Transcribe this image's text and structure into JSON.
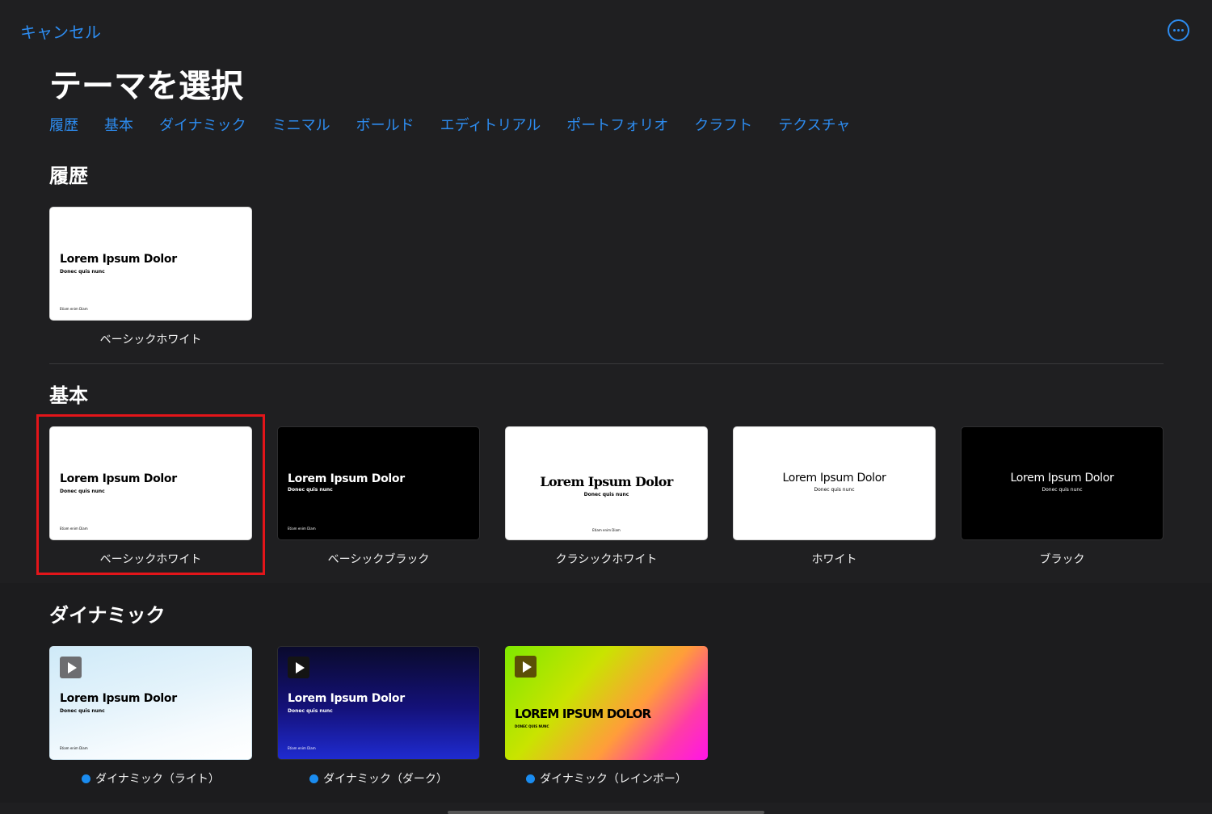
{
  "header": {
    "cancel_label": "キャンセル",
    "more_icon": "ellipsis-circle-icon",
    "title": "テーマを選択"
  },
  "categories": [
    "履歴",
    "基本",
    "ダイナミック",
    "ミニマル",
    "ボールド",
    "エディトリアル",
    "ポートフォリオ",
    "クラフト",
    "テクスチャ"
  ],
  "sections": {
    "recent": {
      "title": "履歴",
      "themes": [
        {
          "name": "ベーシックホワイト",
          "t1": "Lorem Ipsum Dolor",
          "t2": "Donec quis nunc",
          "t3": "Etiam enim Diam"
        }
      ]
    },
    "basic": {
      "title": "基本",
      "themes": [
        {
          "name": "ベーシックホワイト",
          "t1": "Lorem Ipsum Dolor",
          "t2": "Donec quis nunc",
          "t3": "Etiam enim Diam"
        },
        {
          "name": "ベーシックブラック",
          "t1": "Lorem Ipsum Dolor",
          "t2": "Donec quis nunc",
          "t3": "Etiam enim Diam"
        },
        {
          "name": "クラシックホワイト",
          "t1": "Lorem Ipsum Dolor",
          "t2": "Donec quis nunc",
          "t3": "Etiam enim Diam"
        },
        {
          "name": "ホワイト",
          "t1": "Lorem Ipsum Dolor",
          "t2": "Donec quis nunc"
        },
        {
          "name": "ブラック",
          "t1": "Lorem Ipsum Dolor",
          "t2": "Donec quis nunc"
        }
      ]
    },
    "dynamic": {
      "title": "ダイナミック",
      "themes": [
        {
          "name": "ダイナミック（ライト）",
          "t1": "Lorem Ipsum Dolor",
          "t2": "Donec quis nunc",
          "t3": "Etiam enim Diam"
        },
        {
          "name": "ダイナミック（ダーク）",
          "t1": "Lorem Ipsum Dolor",
          "t2": "Donec quis nunc",
          "t3": "Etiam enim Diam"
        },
        {
          "name": "ダイナミック（レインボー）",
          "t1": "LOREM IPSUM DOLOR",
          "t2": "DONEC QUIS NUNC"
        }
      ]
    }
  },
  "selected_theme_highlight_color": "#e3151a",
  "accent_color": "#2d8cf0"
}
